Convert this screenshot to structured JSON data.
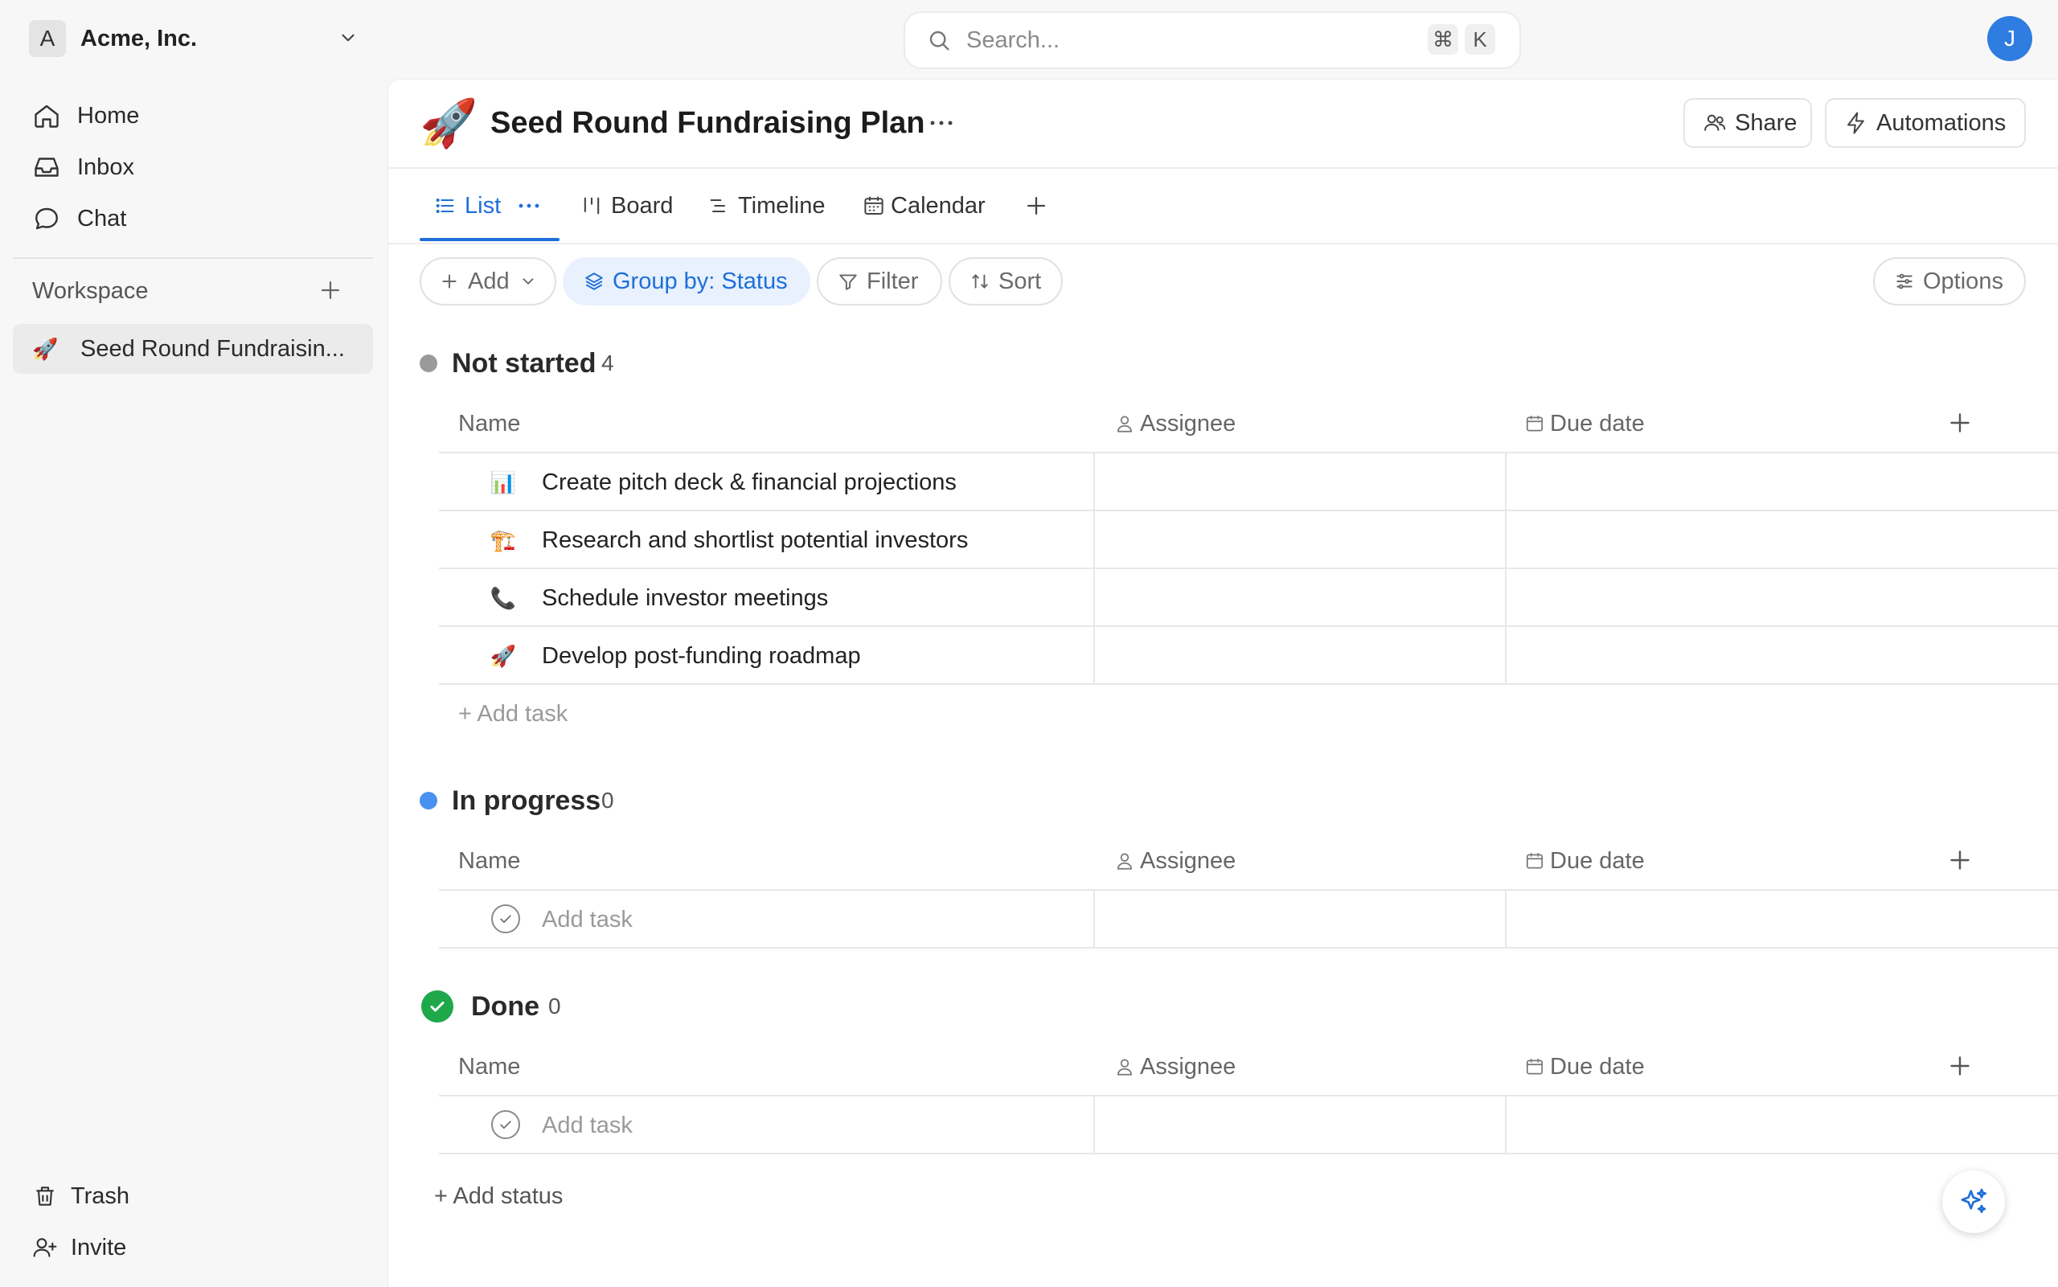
{
  "org": {
    "initial": "A",
    "name": "Acme, Inc."
  },
  "nav": {
    "home": "Home",
    "inbox": "Inbox",
    "chat": "Chat"
  },
  "workspace": {
    "label": "Workspace",
    "items": [
      {
        "emoji": "🚀",
        "label": "Seed Round Fundraisin..."
      }
    ]
  },
  "footer_nav": {
    "trash": "Trash",
    "invite": "Invite"
  },
  "search": {
    "placeholder": "Search...",
    "kbd_cmd": "⌘",
    "kbd_key": "K"
  },
  "user": {
    "initial": "J",
    "avatar_color": "#2f7de1"
  },
  "page": {
    "emoji": "🚀",
    "title": "Seed Round Fundraising Plan",
    "more": "···",
    "share_label": "Share",
    "automations_label": "Automations"
  },
  "tabs": [
    {
      "label": "List",
      "icon": "list-icon",
      "active": true
    },
    {
      "label": "Board",
      "icon": "board-icon"
    },
    {
      "label": "Timeline",
      "icon": "timeline-icon"
    },
    {
      "label": "Calendar",
      "icon": "calendar-icon"
    }
  ],
  "toolbar": {
    "add_label": "Add",
    "group_label": "Group by: Status",
    "filter_label": "Filter",
    "sort_label": "Sort",
    "options_label": "Options"
  },
  "columns": {
    "name": "Name",
    "assignee": "Assignee",
    "due_date": "Due date"
  },
  "groups": [
    {
      "title": "Not started",
      "count": "4",
      "color": "#9a9a9a",
      "tasks": [
        {
          "emoji": "📊",
          "name": "Create pitch deck & financial projections"
        },
        {
          "emoji": "🏗️",
          "name": "Research and shortlist potential investors"
        },
        {
          "emoji": "📞",
          "name": "Schedule investor meetings"
        },
        {
          "emoji": "🚀",
          "name": "Develop post-funding roadmap"
        }
      ],
      "add_task_label": "+ Add task"
    },
    {
      "title": "In progress",
      "count": "0",
      "color": "#4a90f0",
      "add_task_label": "Add task"
    },
    {
      "title": "Done",
      "count": "0",
      "color": "#1ea84a",
      "add_task_label": "Add task"
    }
  ],
  "add_status_label": "+ Add status",
  "colors": {
    "accent": "#1e6fd9",
    "active_tab": "#1e6fd9"
  }
}
